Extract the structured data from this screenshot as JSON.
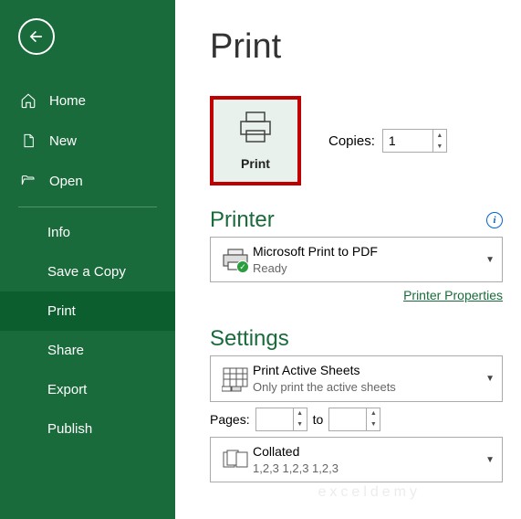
{
  "title": "Print",
  "sidebar": {
    "home": "Home",
    "new": "New",
    "open": "Open",
    "info": "Info",
    "save_copy": "Save a Copy",
    "print": "Print",
    "share": "Share",
    "export": "Export",
    "publish": "Publish"
  },
  "print_button": {
    "label": "Print"
  },
  "copies": {
    "label": "Copies:",
    "value": "1"
  },
  "printer": {
    "heading": "Printer",
    "name": "Microsoft Print to PDF",
    "status": "Ready",
    "properties_link": "Printer Properties"
  },
  "settings": {
    "heading": "Settings",
    "sheets_title": "Print Active Sheets",
    "sheets_sub": "Only print the active sheets",
    "pages_label": "Pages:",
    "pages_from": "",
    "pages_to_label": "to",
    "pages_to": "",
    "collated_title": "Collated",
    "collated_sub": "1,2,3    1,2,3    1,2,3"
  }
}
